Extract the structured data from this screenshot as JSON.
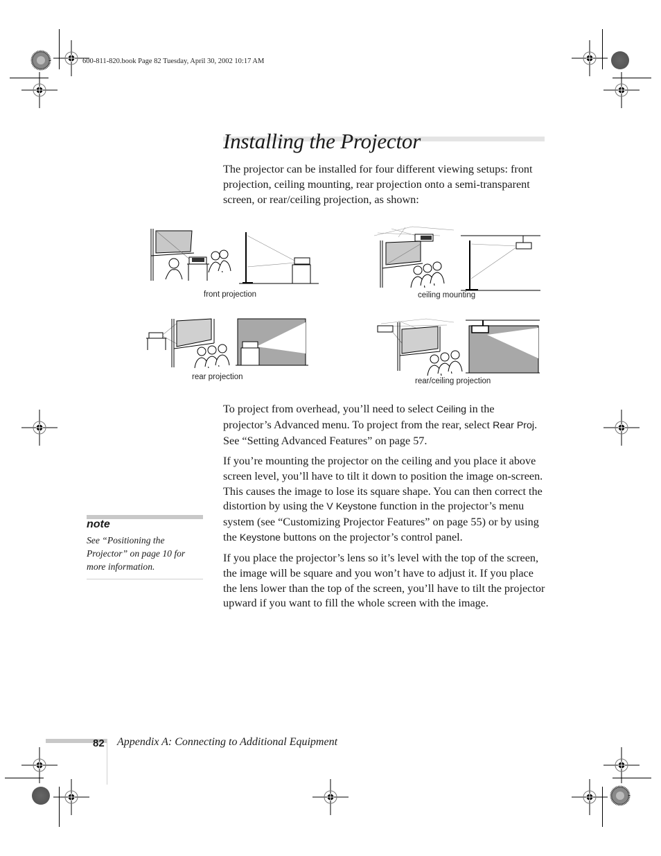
{
  "header": {
    "slug_text": "600-811-820.book  Page 82  Tuesday, April 30, 2002  10:17 AM"
  },
  "section": {
    "title": "Installing the Projector",
    "intro": "The projector can be installed for four different viewing setups: front projection, ceiling mounting, rear projection onto a semi-transparent screen, or rear/ceiling projection, as shown:"
  },
  "figures": [
    {
      "caption": "front projection"
    },
    {
      "caption": "ceiling mounting"
    },
    {
      "caption": "rear projection"
    },
    {
      "caption": "rear/ceiling projection"
    }
  ],
  "body": {
    "p1": {
      "a": "To project from overhead, you’ll need to select ",
      "ui1": "Ceiling",
      "b": " in the projector’s Advanced menu. To project from the rear, select ",
      "ui2": "Rear Proj",
      "c": ". See “Setting Advanced Features” on page 57."
    },
    "p2": {
      "a": "If you’re mounting the projector on the ceiling and you place it above screen level, you’ll have to tilt it down to position the image on-screen. This causes the image to lose its square shape. You can then correct the distortion by using the ",
      "ui1": "V Keystone",
      "b": " function in the projector’s menu system (see “Customizing Projector Features” on page 55) or by using the ",
      "ui2": "Keystone",
      "c": " buttons on the projector’s control panel."
    },
    "p3": "If you place the projector’s lens so it’s level with the top of the screen, the image will be square and you won’t have to adjust it. If you place the lens lower than the top of the screen, you’ll have to tilt the projector upward if you want to fill the whole screen with the image."
  },
  "note": {
    "label": "note",
    "text": "See “Positioning the Projector” on page 10 for more information."
  },
  "footer": {
    "page_number": "82",
    "chapter_title": "Appendix A: Connecting to Additional Equipment"
  }
}
